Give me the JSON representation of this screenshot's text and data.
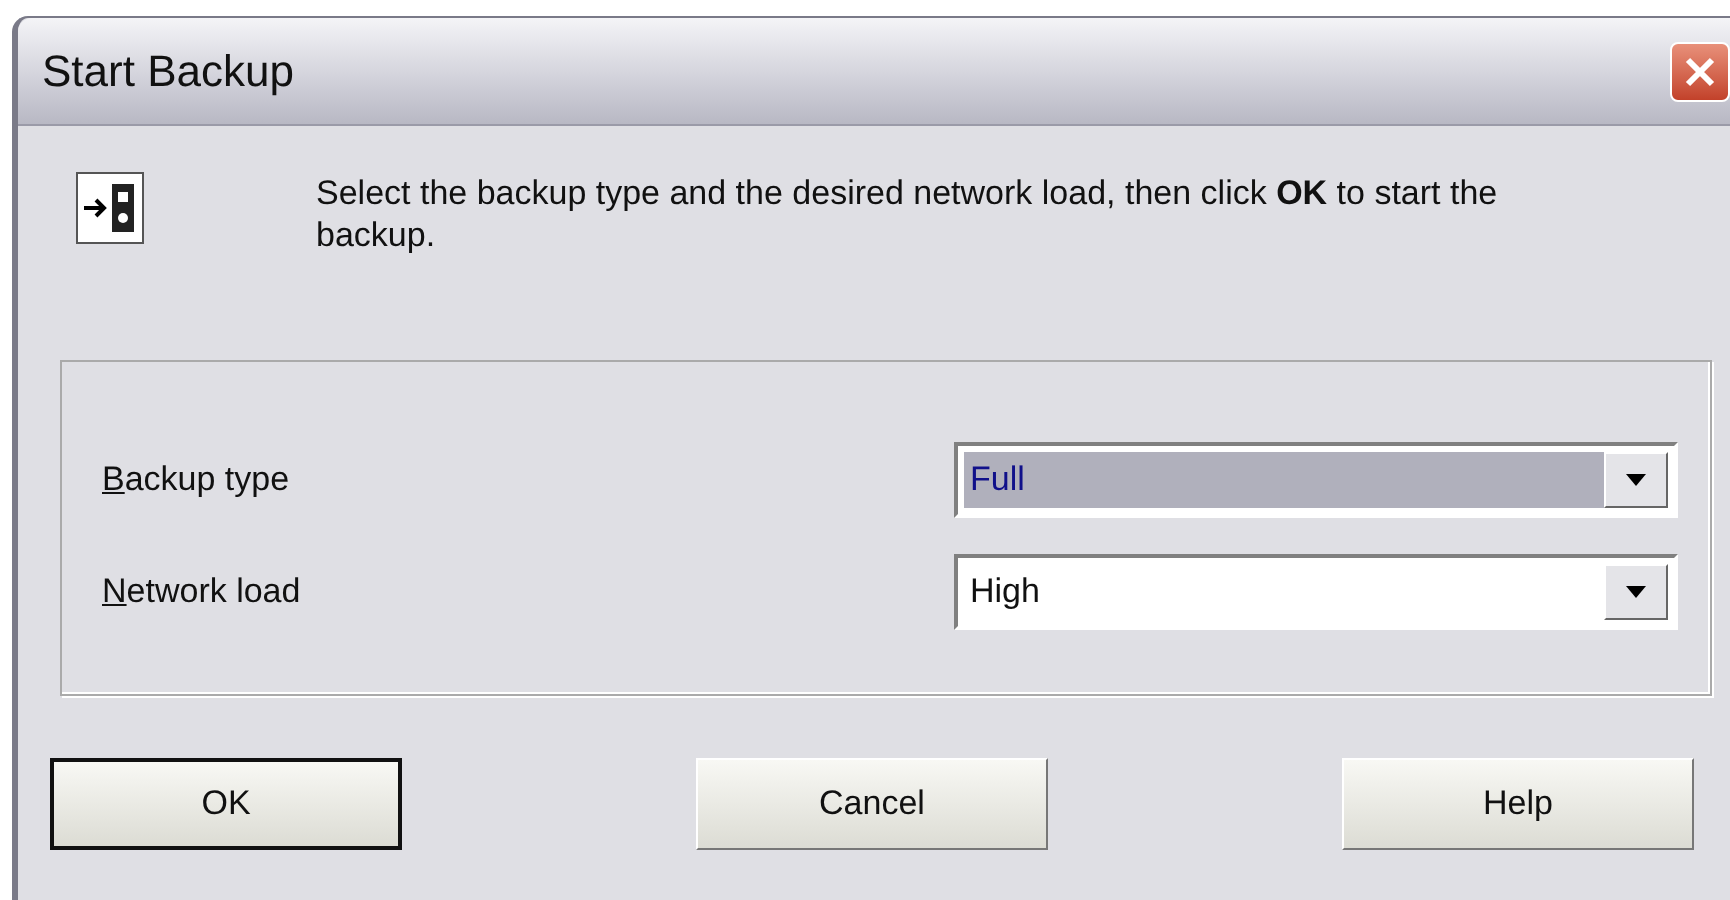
{
  "window": {
    "title": "Start Backup"
  },
  "message": "Select the backup type and the desired network load, then click **OK** to start the backup.",
  "fields": [
    {
      "label": "Backup type",
      "value": "Full",
      "focused": true
    },
    {
      "label": "Network load",
      "value": "High",
      "focused": false
    }
  ],
  "buttons": [
    {
      "label": "OK",
      "default": true
    },
    {
      "label": "Cancel",
      "default": false
    },
    {
      "label": "Help",
      "default": false
    }
  ]
}
